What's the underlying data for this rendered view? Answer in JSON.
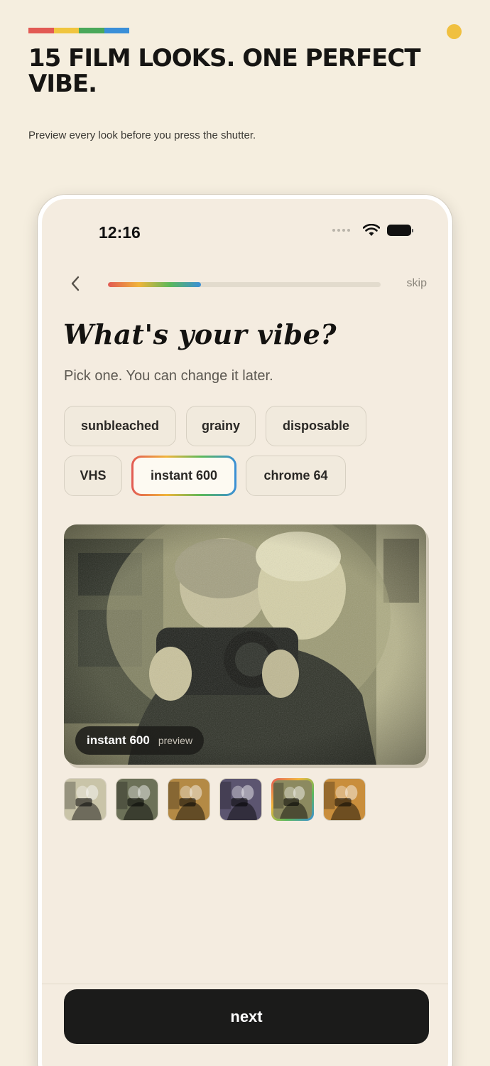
{
  "page": {
    "headline": "15 FILM LOOKS. ONE PERFECT VIBE.",
    "subline": "Preview every look before you press the shutter.",
    "stripe_colors": [
      "#e25a54",
      "#f0c53e",
      "#4aa85a",
      "#3a8fd8"
    ],
    "accent_dot_color": "#f0c040"
  },
  "status_bar": {
    "time": "12:16",
    "icons": [
      "signal-dots-icon",
      "wifi-icon",
      "battery-icon"
    ]
  },
  "nav": {
    "back_icon": "chevron-left-icon",
    "skip_label": "skip",
    "progress": 0.34
  },
  "onboarding": {
    "title": "What's your vibe?",
    "hint": "Pick one. You can change it later."
  },
  "filters": [
    {
      "label": "sunbleached",
      "selected": false
    },
    {
      "label": "grainy",
      "selected": false
    },
    {
      "label": "disposable",
      "selected": false
    },
    {
      "label": "VHS",
      "selected": false
    },
    {
      "label": "instant 600",
      "selected": true
    },
    {
      "label": "chrome 64",
      "selected": false
    }
  ],
  "preview": {
    "filter_name": "instant 600",
    "badge_sub": "preview"
  },
  "thumbnails": [
    {
      "tone": "#c9c4a8",
      "selected": false
    },
    {
      "tone": "#6c7158",
      "selected": false
    },
    {
      "tone": "#b48a45",
      "selected": false
    },
    {
      "tone": "#5c5570",
      "selected": false
    },
    {
      "tone": "#8c8a60",
      "selected": true
    },
    {
      "tone": "#c98e3c",
      "selected": false
    }
  ],
  "footer": {
    "next_label": "next"
  }
}
